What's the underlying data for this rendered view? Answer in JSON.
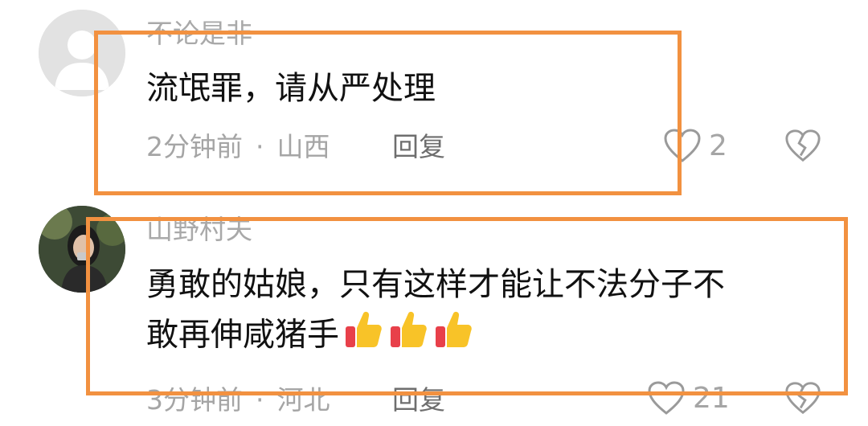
{
  "comments": [
    {
      "username": "不论是非",
      "content": "流氓罪，请从严处理",
      "time": "2分钟前",
      "separator": "·",
      "location": "山西",
      "reply_label": "回复",
      "likes": "2",
      "avatar": "default-avatar-icon"
    },
    {
      "username": "山野村夫",
      "content_line1": "勇敢的姑娘，只有这样才能让不法分子不",
      "content_line2": "敢再伸咸猪手",
      "emoji": [
        "thumbs-up-icon",
        "thumbs-up-icon",
        "thumbs-up-icon"
      ],
      "time": "3分钟前",
      "separator": "·",
      "location": "河北",
      "reply_label": "回复",
      "likes": "21",
      "avatar": "photo-avatar"
    }
  ],
  "colors": {
    "highlight": "#f29140",
    "meta_text": "#a5a5a5",
    "username_text": "#a9a9a9"
  }
}
